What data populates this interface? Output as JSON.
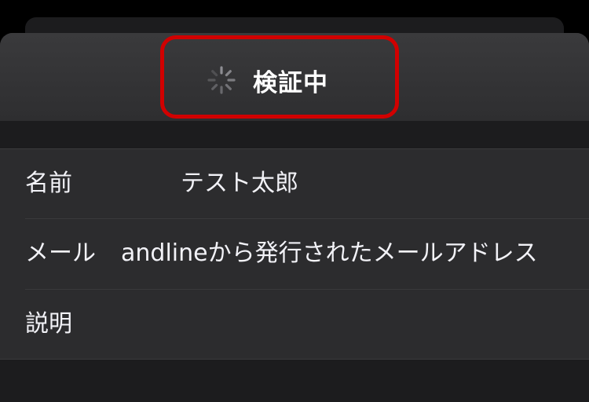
{
  "status": {
    "spinner_icon": "spinner-icon",
    "title": "検証中"
  },
  "fields": {
    "name": {
      "label": "名前",
      "value": "テスト太郎"
    },
    "mail": {
      "label": "メール",
      "value": "andlineから発行されたメールアドレス"
    },
    "description": {
      "label": "説明",
      "value": ""
    }
  },
  "colors": {
    "highlight": "#d10000",
    "sheet": "#2c2c2e",
    "background": "#000000"
  }
}
